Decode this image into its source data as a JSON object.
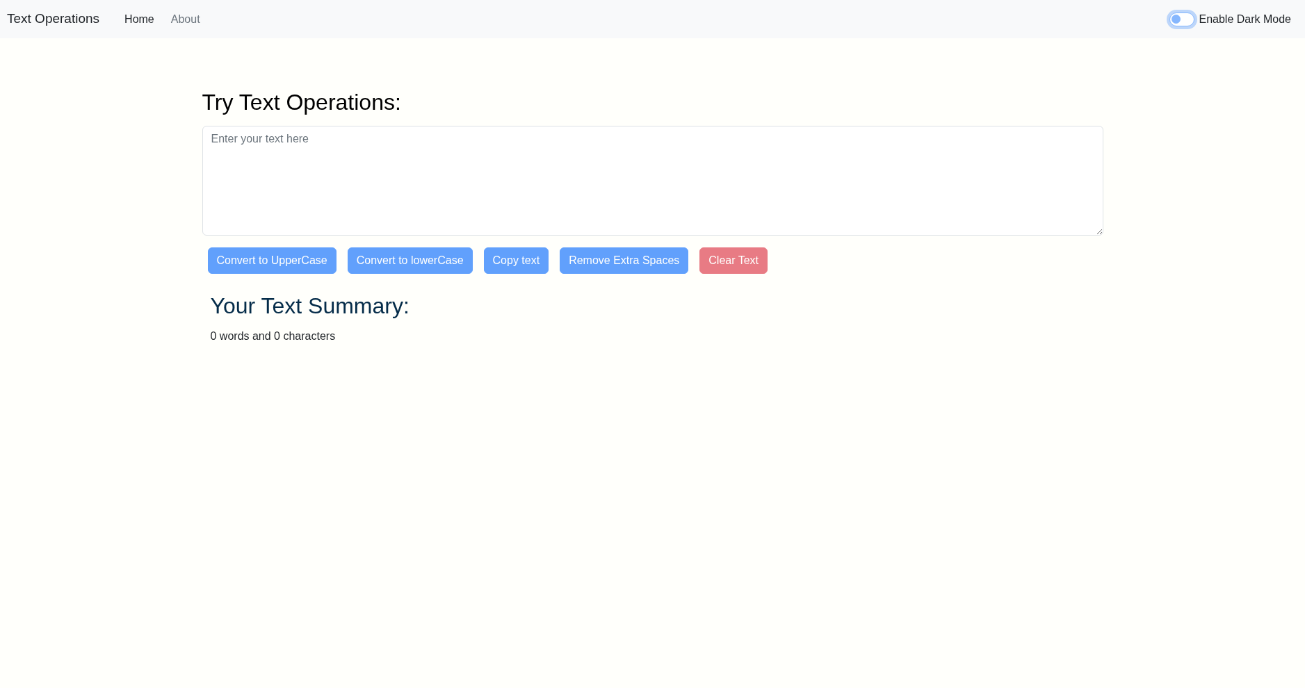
{
  "navbar": {
    "brand": "Text Operations",
    "links": [
      {
        "label": "Home",
        "selected": true
      },
      {
        "label": "About",
        "selected": false
      }
    ],
    "dark_mode_switch": {
      "label": "Enable Dark Mode",
      "on": false
    }
  },
  "heading": "Try Text Operations:",
  "textarea": {
    "placeholder": "Enter your text here"
  },
  "buttons": [
    {
      "label": "Convert to UpperCase",
      "kind": "primary",
      "disabled": true
    },
    {
      "label": "Convert to lowerCase",
      "kind": "primary",
      "disabled": true
    },
    {
      "label": "Copy text",
      "kind": "primary",
      "disabled": true
    },
    {
      "label": "Remove Extra Spaces",
      "kind": "primary",
      "disabled": true
    },
    {
      "label": "Clear Text",
      "kind": "danger",
      "disabled": true
    }
  ],
  "summary": {
    "heading": "Your Text Summary:",
    "text": "0 words and 0 characters"
  }
}
